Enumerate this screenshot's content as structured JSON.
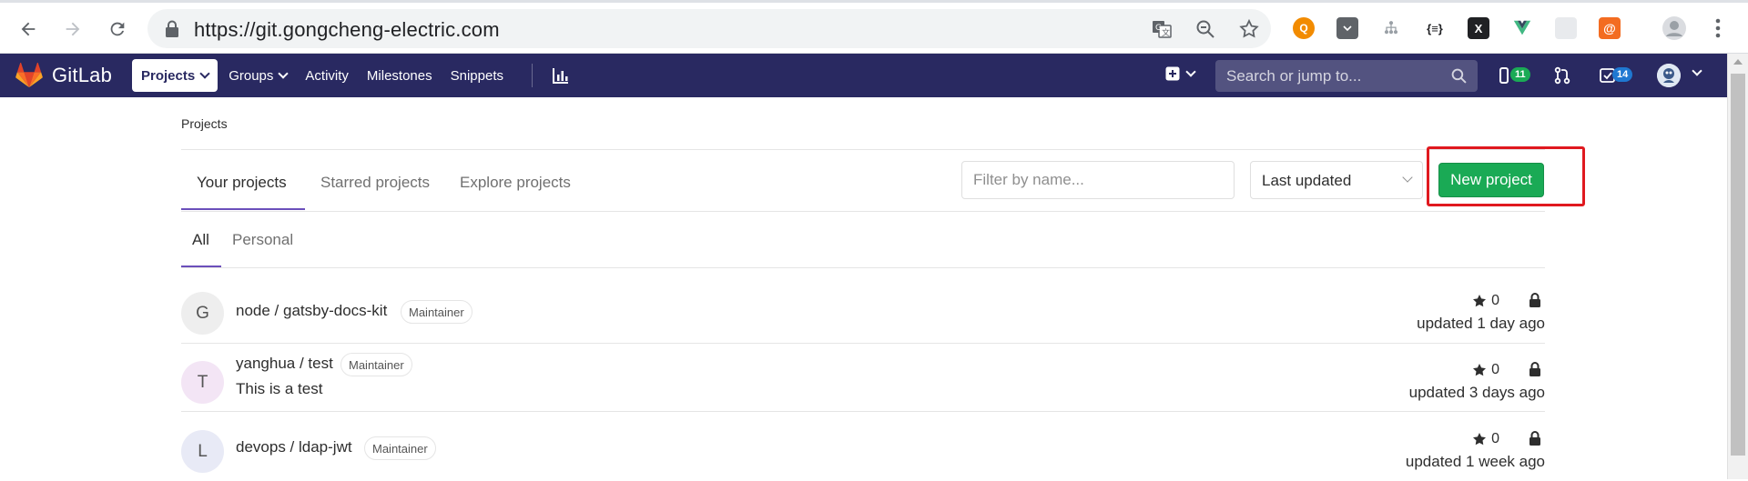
{
  "browser": {
    "url": "https://git.gongcheng-electric.com"
  },
  "gitlab": {
    "brand": "GitLab",
    "menu": [
      {
        "label": "Projects",
        "active": true
      },
      {
        "label": "Groups"
      },
      {
        "label": "Activity"
      },
      {
        "label": "Milestones"
      },
      {
        "label": "Snippets"
      }
    ],
    "search_placeholder": "Search or jump to...",
    "issues_count": "11",
    "todos_count": "14"
  },
  "page": {
    "breadcrumb": "Projects",
    "tabs": [
      "Your projects",
      "Starred projects",
      "Explore projects"
    ],
    "filter_placeholder": "Filter by name...",
    "sort_value": "Last updated",
    "new_project_label": "New project",
    "subtabs": [
      "All",
      "Personal"
    ]
  },
  "projects": [
    {
      "initial": "G",
      "name": "node / gatsby-docs-kit",
      "role": "Maintainer",
      "description": "",
      "stars": "0",
      "updated": "updated 1 day ago",
      "avatar_color": "#eeeeee"
    },
    {
      "initial": "T",
      "name": "yanghua / test",
      "role": "Maintainer",
      "description": "This is a test",
      "stars": "0",
      "updated": "updated 3 days ago",
      "avatar_color": "#f3e5f5"
    },
    {
      "initial": "L",
      "name": "devops / ldap-jwt",
      "role": "Maintainer",
      "description": "",
      "stars": "0",
      "updated": "updated 1 week ago",
      "avatar_color": "#e8eaf6"
    }
  ],
  "colors": {
    "nav_bg": "#292961",
    "primary_green": "#1aaa55",
    "tab_active": "#6b4fbb",
    "highlight_red": "#e0191f"
  }
}
